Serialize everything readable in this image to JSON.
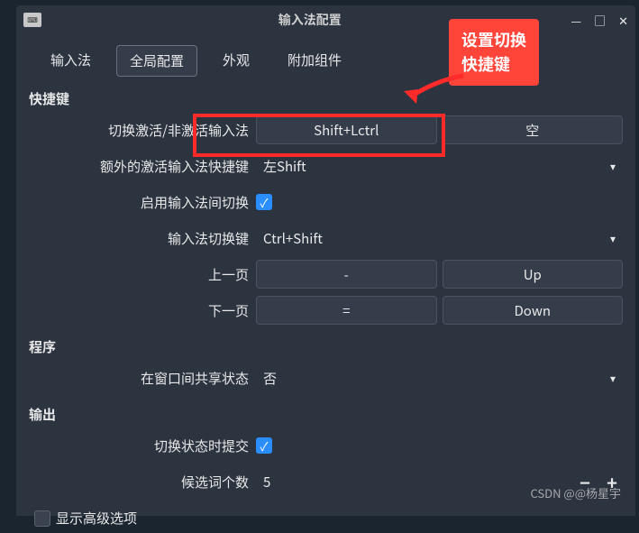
{
  "titlebar": {
    "title": "输入法配置"
  },
  "tabs": {
    "items": [
      {
        "label": "输入法"
      },
      {
        "label": "全局配置"
      },
      {
        "label": "外观"
      },
      {
        "label": "附加组件"
      }
    ]
  },
  "callout": {
    "line1": "设置切换",
    "line2": "快捷键"
  },
  "sections": {
    "shortcut": {
      "header": "快捷键"
    },
    "program": {
      "header": "程序"
    },
    "output": {
      "header": "输出"
    }
  },
  "rows": {
    "trigger": {
      "label": "切换激活/非激活输入法",
      "btn1": "Shift+Lctrl",
      "btn2": "空"
    },
    "extra_trigger": {
      "label": "额外的激活输入法快捷键",
      "value": "左Shift"
    },
    "enable_switch": {
      "label": "启用输入法间切换"
    },
    "scroll_key": {
      "label": "输入法切换键",
      "value": "Ctrl+Shift"
    },
    "prev_page": {
      "label": "上一页",
      "btn1": "-",
      "btn2": "Up"
    },
    "next_page": {
      "label": "下一页",
      "btn1": "=",
      "btn2": "Down"
    },
    "share_state": {
      "label": "在窗口间共享状态",
      "value": "否"
    },
    "commit_switch": {
      "label": "切换状态时提交"
    },
    "candidate_count": {
      "label": "候选词个数",
      "value": "5"
    },
    "advanced": {
      "label": "显示高级选项"
    }
  },
  "watermark": "CSDN @@杨星宇"
}
